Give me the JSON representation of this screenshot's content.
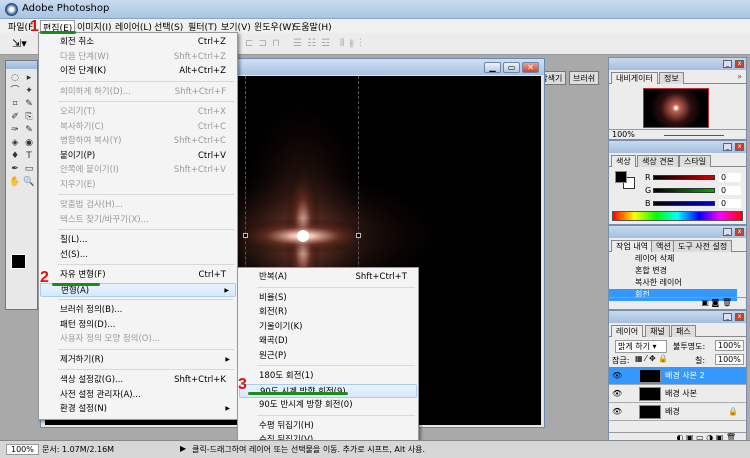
{
  "app": {
    "title": "Adobe Photoshop"
  },
  "menubar": [
    "파일(F)",
    "편집(E)",
    "이미지(I)",
    "레이어(L)",
    "선택(S)",
    "필터(T)",
    "보기(V)",
    "윈도우(W)",
    "도움말(H)"
  ],
  "options_bar": {
    "tool_icon": "move-tool-icon",
    "ghost_align": "⊏ ⊐ ⊓",
    "ghost_dist": "☰ ☷ ☲",
    "ghost_misc": "⫴ ⫵ ⫶",
    "well_tabs": [
      "파일 탐색기",
      "브러쉬"
    ]
  },
  "edit_menu": [
    {
      "label": "회전 취소",
      "shortcut": "Ctrl+Z"
    },
    {
      "label": "다음 단계(W)",
      "shortcut": "Shft+Ctrl+Z",
      "disabled": true
    },
    {
      "label": "이전 단계(K)",
      "shortcut": "Alt+Ctrl+Z"
    },
    {
      "sep": true
    },
    {
      "label": "희미하게 하기(D)...",
      "shortcut": "Shft+Ctrl+F",
      "disabled": true
    },
    {
      "sep": true
    },
    {
      "label": "오리기(T)",
      "shortcut": "Ctrl+X",
      "disabled": true
    },
    {
      "label": "복사하기(C)",
      "shortcut": "Ctrl+C",
      "disabled": true
    },
    {
      "label": "병합하여 복사(Y)",
      "shortcut": "Shft+Ctrl+C",
      "disabled": true
    },
    {
      "label": "붙이기(P)",
      "shortcut": "Ctrl+V"
    },
    {
      "label": "안쪽에 붙이기(I)",
      "shortcut": "Shft+Ctrl+V",
      "disabled": true
    },
    {
      "label": "지우기(E)",
      "disabled": true
    },
    {
      "sep": true
    },
    {
      "label": "맞춤법 검사(H)...",
      "disabled": true
    },
    {
      "label": "텍스트 찾기/바꾸기(X)...",
      "disabled": true
    },
    {
      "sep": true
    },
    {
      "label": "칠(L)..."
    },
    {
      "label": "선(S)..."
    },
    {
      "sep": true
    },
    {
      "label": "자유 변형(F)",
      "shortcut": "Ctrl+T"
    },
    {
      "label": "변형(A)",
      "submenu": true,
      "highlighted": true
    },
    {
      "sep": true
    },
    {
      "label": "브러쉬 정의(B)..."
    },
    {
      "label": "패턴 정의(D)..."
    },
    {
      "label": "사용자 정의 모양 정의(O)...",
      "disabled": true
    },
    {
      "sep": true
    },
    {
      "label": "제거하기(R)",
      "submenu": true
    },
    {
      "sep": true
    },
    {
      "label": "색상 설정값(G)...",
      "shortcut": "Shft+Ctrl+K"
    },
    {
      "label": "사전 설정 관리자(A)..."
    },
    {
      "label": "환경 설정(N)",
      "submenu": true
    }
  ],
  "transform_submenu": [
    {
      "label": "반복(A)",
      "shortcut": "Shft+Ctrl+T"
    },
    {
      "sep": true
    },
    {
      "label": "비율(S)"
    },
    {
      "label": "회전(R)"
    },
    {
      "label": "기울이기(K)"
    },
    {
      "label": "왜곡(D)"
    },
    {
      "label": "원근(P)"
    },
    {
      "sep": true
    },
    {
      "label": "180도 회전(1)"
    },
    {
      "label": "90도 시계 방향 회전(9)",
      "highlighted": true
    },
    {
      "label": "90도 반시계 방향 회전(0)"
    },
    {
      "sep": true
    },
    {
      "label": "수평 뒤집기(H)"
    },
    {
      "label": "수직 뒤집기(V)"
    }
  ],
  "annotations": [
    "1",
    "2",
    "3"
  ],
  "navigator": {
    "tabs": [
      "내비게이터",
      "정보"
    ],
    "zoom": "100%"
  },
  "color": {
    "tabs": [
      "색상",
      "색상 견본",
      "스타일"
    ],
    "channels": [
      {
        "name": "R",
        "value": "0",
        "color": "#d00000"
      },
      {
        "name": "G",
        "value": "0",
        "color": "#00b000"
      },
      {
        "name": "B",
        "value": "0",
        "color": "#0000d0"
      }
    ]
  },
  "history": {
    "tabs": [
      "작업 내역",
      "액션",
      "도구 사전 설정"
    ],
    "items": [
      "레이어 삭제",
      "혼합 변경",
      "복사한 레이어",
      "회전"
    ],
    "selected": 3
  },
  "layers": {
    "tabs": [
      "레이어",
      "채널",
      "패스"
    ],
    "blend_mode": "밝게 하기",
    "opacity_label": "불투명도:",
    "opacity": "100%",
    "lock_label": "잠금:",
    "fill_label": "칠:",
    "fill": "100%",
    "items": [
      "배경 사본 2",
      "배경 사본",
      "배경"
    ],
    "selected": 0
  },
  "status": {
    "zoom": "100%",
    "doc": "문서: 1.07M/2.16M",
    "hint": "클릭-드래그하여 레이어 또는 선택물을 이동. 추가로 시프트, Alt 사용."
  },
  "colors": {
    "highlight": "#3399ff",
    "annotation_num": "#e01010",
    "annotation_line": "#1e8a1e"
  }
}
